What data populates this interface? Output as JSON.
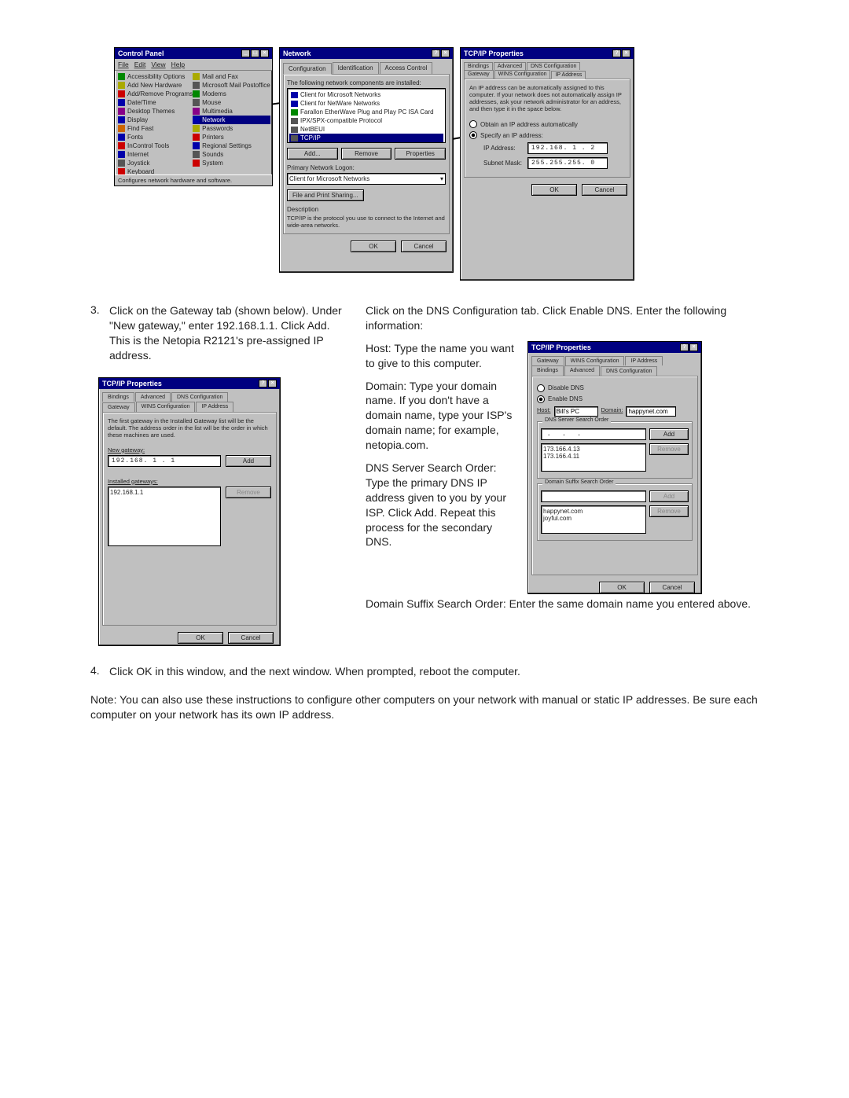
{
  "control_panel": {
    "title": "Control Panel",
    "menu": [
      "File",
      "Edit",
      "View",
      "Help"
    ],
    "col1": [
      "Accessibility Options",
      "Add New Hardware",
      "Add/Remove Programs",
      "Date/Time",
      "Desktop Themes",
      "Display",
      "Find Fast",
      "Fonts",
      "InControl Tools",
      "Internet",
      "Joystick",
      "Keyboard"
    ],
    "col2": [
      "Mail and Fax",
      "Microsoft Mail Postoffice",
      "Modems",
      "Mouse",
      "Multimedia",
      "Network",
      "Passwords",
      "Printers",
      "Regional Settings",
      "Sounds",
      "System"
    ],
    "selected": "Network",
    "status": "Configures network hardware and software."
  },
  "network": {
    "title": "Network",
    "tabs": [
      "Configuration",
      "Identification",
      "Access Control"
    ],
    "components_label": "The following network components are installed:",
    "components": [
      "Client for Microsoft Networks",
      "Client for NetWare Networks",
      "Farallon EtherWave Plug and Play PC ISA Card",
      "IPX/SPX-compatible Protocol",
      "NetBEUI",
      "TCP/IP"
    ],
    "selected_component": "TCP/IP",
    "btn_add": "Add...",
    "btn_remove": "Remove",
    "btn_props": "Properties",
    "logon_label": "Primary Network Logon:",
    "logon_value": "Client for Microsoft Networks",
    "file_share": "File and Print Sharing...",
    "desc_label": "Description",
    "desc_text": "TCP/IP is the protocol you use to connect to the Internet and wide-area networks.",
    "ok": "OK",
    "cancel": "Cancel"
  },
  "tcpip": {
    "title": "TCP/IP Properties",
    "tabs_row1": [
      "Bindings",
      "Advanced",
      "DNS Configuration"
    ],
    "tabs_row2": [
      "Gateway",
      "WINS Configuration",
      "IP Address"
    ],
    "intro": "An IP address can be automatically assigned to this computer. If your network does not automatically assign IP addresses, ask your network administrator for an address, and then type it in the space below.",
    "opt_obtain": "Obtain an IP address automatically",
    "opt_specify": "Specify an IP address:",
    "ip_label": "IP Address:",
    "ip_value": "192.168. 1 . 2",
    "mask_label": "Subnet Mask:",
    "mask_value": "255.255.255. 0",
    "ok": "OK",
    "cancel": "Cancel"
  },
  "gateway": {
    "title": "TCP/IP Properties",
    "tabs_row1": [
      "Bindings",
      "Advanced",
      "DNS Configuration"
    ],
    "tabs_row2": [
      "Gateway",
      "WINS Configuration",
      "IP Address"
    ],
    "help": "The first gateway in the Installed Gateway list will be the default. The address order in the list will be the order in which these machines are used.",
    "new_label": "New gateway:",
    "new_value": "192.168. 1 . 1",
    "add": "Add",
    "installed_label": "Installed gateways:",
    "installed_value": "192.168.1.1",
    "remove": "Remove",
    "ok": "OK",
    "cancel": "Cancel"
  },
  "dns": {
    "title": "TCP/IP Properties",
    "tabs_row1": [
      "Gateway",
      "WINS Configuration",
      "IP Address"
    ],
    "tabs_row2": [
      "Bindings",
      "Advanced",
      "DNS Configuration"
    ],
    "opt_disable": "Disable DNS",
    "opt_enable": "Enable DNS",
    "host_label": "Host:",
    "host_value": "Bill's PC",
    "domain_label": "Domain:",
    "domain_value": "happynet.com",
    "search_group": "DNS Server Search Order",
    "search_input": " .   .   .",
    "add": "Add",
    "servers": [
      "173.166.4.13",
      "173.166.4.11"
    ],
    "remove": "Remove",
    "suffix_group": "Domain Suffix Search Order",
    "suffix_add": "Add",
    "suffixes": [
      "happynet.com",
      "joyful.com"
    ],
    "suffix_remove": "Remove",
    "ok": "OK",
    "cancel": "Cancel"
  },
  "text": {
    "step3_num": "3.",
    "step3": "Click on the Gateway tab (shown below). Under \"New gateway,\" enter 192.168.1.1. Click Add. This is the Netopia R2121's pre-assigned IP address.",
    "right_lead": "Click on the DNS Configuration tab. Click Enable DNS. Enter the following information:",
    "host_para": "Host: Type the name you want to give to this computer.",
    "domain_para": "Domain: Type your domain name. If you don't have a domain name, type your ISP's domain name; for example, netopia.com.",
    "dns_para": "DNS Server Search Order: Type the primary DNS IP address given to you by your ISP. Click Add. Repeat this process for the secondary DNS.",
    "suffix_para": "Domain Suffix Search Order: Enter the same domain name you entered above.",
    "step4_num": "4.",
    "step4": "Click OK in this window, and the next window. When prompted, reboot the computer.",
    "note": "Note: You can also use these instructions to configure other computers on your network with manual or static IP addresses. Be sure each computer on your network has its own IP address."
  }
}
